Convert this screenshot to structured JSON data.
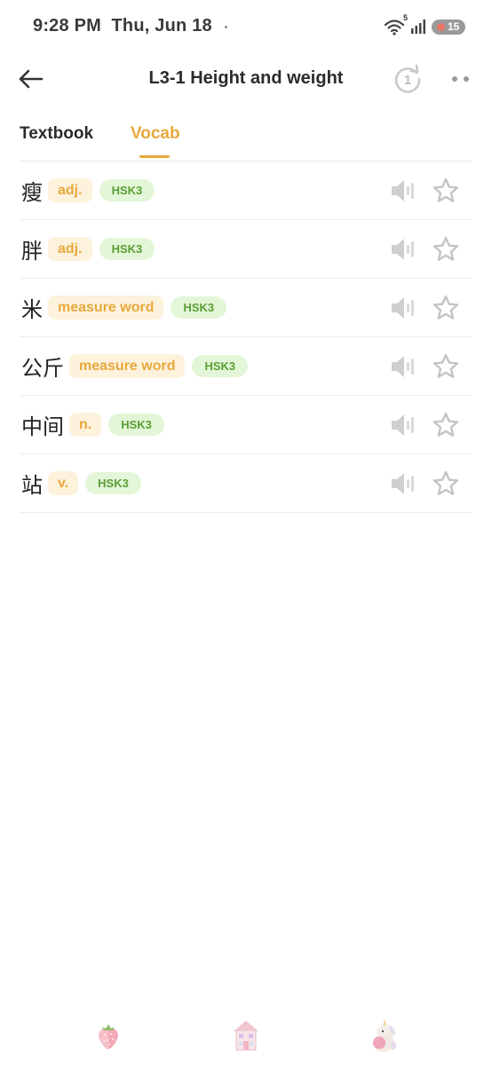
{
  "status_bar": {
    "time": "9:28 PM",
    "date": "Thu, Jun 18",
    "wifi_badge": "5",
    "battery": "15"
  },
  "header": {
    "title": "L3-1 Height and weight",
    "replay_count": "1",
    "back_icon": "arrow-left-icon",
    "more_icon": "more-dots-icon"
  },
  "tabs": [
    {
      "label": "Textbook",
      "active": false
    },
    {
      "label": "Vocab",
      "active": true
    }
  ],
  "vocab": [
    {
      "word": "瘦",
      "pos": "adj.",
      "level": "HSK3"
    },
    {
      "word": "胖",
      "pos": "adj.",
      "level": "HSK3"
    },
    {
      "word": "米",
      "pos": "measure word",
      "level": "HSK3"
    },
    {
      "word": "公斤",
      "pos": "measure word",
      "level": "HSK3"
    },
    {
      "word": "中间",
      "pos": "n.",
      "level": "HSK3"
    },
    {
      "word": "站",
      "pos": "v.",
      "level": "HSK3"
    }
  ],
  "bottom_nav": [
    {
      "icon": "strawberry-icon"
    },
    {
      "icon": "dollhouse-icon"
    },
    {
      "icon": "unicorn-icon"
    }
  ],
  "colors": {
    "accent": "#e8a93d",
    "pos_bg": "#fdf2dc",
    "hsk_bg": "#e3f6d7",
    "hsk_text": "#5a9e36",
    "icon_gray": "#c4c4c4"
  }
}
